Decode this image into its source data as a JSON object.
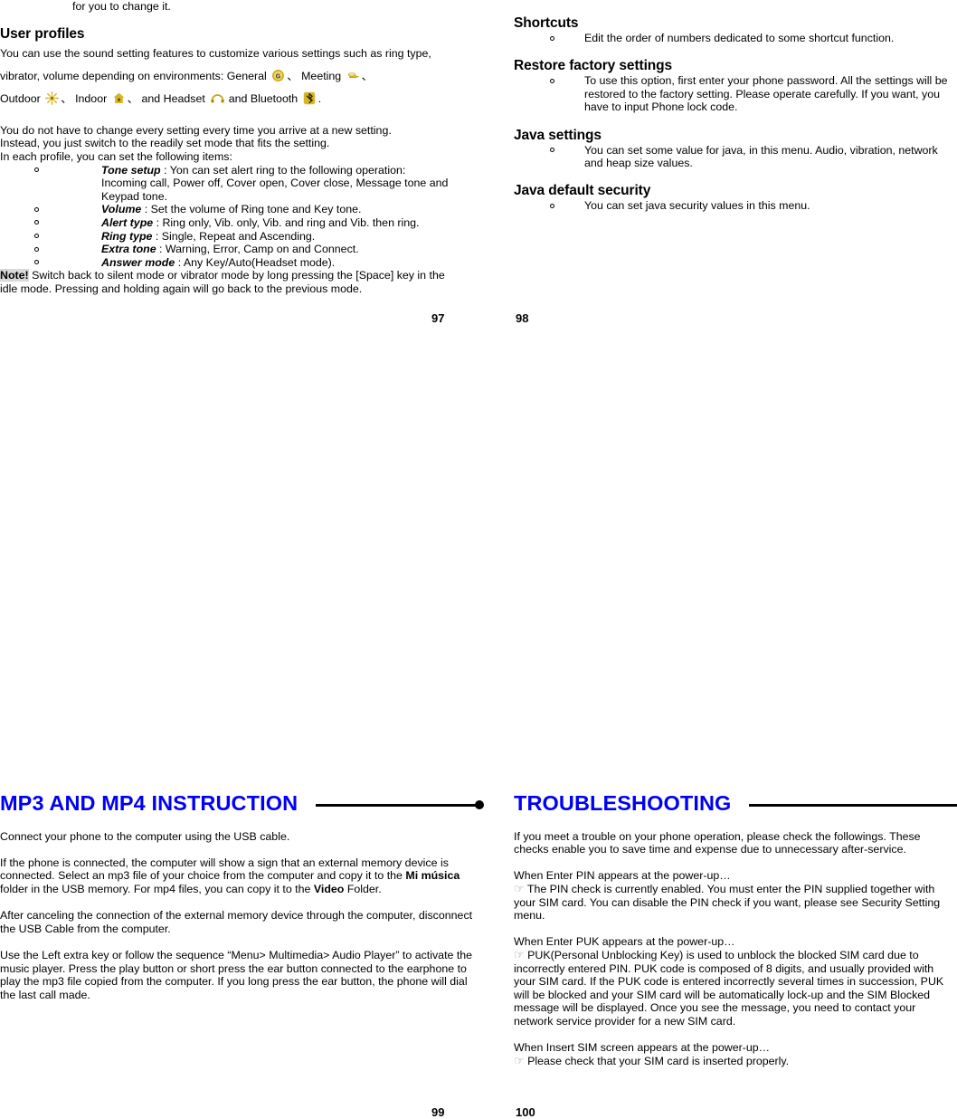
{
  "document": {
    "title": "Mobile Phone User Manual",
    "accent_heading_color": "#0000f5",
    "icon_gold": "#d9b828"
  },
  "page_numbers": {
    "top_left": "97",
    "top_right": "98",
    "bottom_left": "99",
    "bottom_right": "100"
  },
  "top_left_column": {
    "continued_line": "for you to change it.",
    "heading": "User profiles",
    "intro_part1": "You can use the sound setting features to customize various settings such as ring type, vibrator, volume depending on environments: General",
    "sep1": "、",
    "label_meeting": "Meeting",
    "sep2": "、",
    "label_outdoor": "Outdoor",
    "sep3": "、",
    "label_indoor": "Indoor",
    "sep4": "、",
    "label_headset": "and Headset",
    "label_bluetooth": "and Bluetooth",
    "period": ".",
    "paragraph2_line1": "You do not have to change every setting every time you arrive at a new setting.",
    "paragraph2_line2": "Instead, you just switch to the readily set mode that fits the setting.",
    "paragraph2_line3": "In each profile, you can set the following items:",
    "items": [
      {
        "term": "Tone setup",
        "text": " : Yon can set alert ring to the following operation: Incoming call, Power off, Cover open, Cover close, Message tone and Keypad tone."
      },
      {
        "term": "Volume",
        "text": " : Set the volume of Ring tone and Key tone."
      },
      {
        "term": "Alert type",
        "text": " : Ring only, Vib. only, Vib. and ring and Vib. then ring."
      },
      {
        "term": "Ring type",
        "text": " : Single, Repeat and Ascending."
      },
      {
        "term": "Extra tone",
        "text": " : Warning, Error, Camp on and Connect."
      },
      {
        "term": "Answer mode",
        "text": " : Any Key/Auto(Headset mode)."
      }
    ],
    "note_label": "Note!",
    "note_text": " Switch back to silent mode or vibrator mode by long pressing the [Space] key in the idle mode. Pressing and holding again will go back to the previous mode."
  },
  "top_right_column": {
    "sections": [
      {
        "heading": "Shortcuts",
        "items": [
          "Edit the order of numbers dedicated to some shortcut function."
        ]
      },
      {
        "heading": "Restore factory settings",
        "items": [
          "To use this option, first enter your phone password. All the settings will be restored to the factory setting. Please operate carefully. If you want, you have to input Phone lock code."
        ]
      },
      {
        "heading": "Java settings",
        "items": [
          "You can set some value for java, in this menu. Audio, vibration, network and heap size values."
        ]
      },
      {
        "heading": "Java default security",
        "items": [
          "You can set java security values in this menu."
        ]
      }
    ]
  },
  "bottom_left_column": {
    "chapter_title": "MP3 AND MP4 INSTRUCTION",
    "para1": "Connect your phone to the computer using the USB cable.",
    "para2_a": "If the phone is connected, the computer will show a sign that an external memory device is connected. Select an mp3 file of your choice from the computer and copy it to the ",
    "para2_b": "Mi música",
    "para2_c": " folder in the USB memory. For mp4 files, you can copy it to the ",
    "para2_d": "Video",
    "para2_e": " Folder.",
    "para3": "After canceling the connection of the external memory device through the computer, disconnect the USB Cable from the computer.",
    "para4": "Use the Left extra key or follow the sequence “Menu> Multimedia> Audio Player” to activate the music player. Press the play button or short press the ear button connected to the earphone to play the mp3 file copied from the computer. If you long press the ear button, the phone will dial the last call made."
  },
  "bottom_right_column": {
    "chapter_title": "TROUBLESHOOTING",
    "intro": "If you meet a trouble on your phone operation, please check the followings. These checks enable you to save time and expense due to unnecessary after-service.",
    "entries": [
      {
        "question": "When Enter PIN appears at the power-up…",
        "hand_icon": "☞",
        "answer": "The PIN check is currently enabled. You must enter the PIN supplied together with your SIM card. You can disable the PIN check if you want, please see Security Setting menu."
      },
      {
        "question": "When Enter PUK appears at the power-up…",
        "hand_icon": "☞",
        "answer": "PUK(Personal Unblocking Key) is used to unblock the blocked SIM card due to incorrectly entered PIN. PUK code is composed of 8 digits, and usually provided with your SIM card. If the PUK code is entered incorrectly several times in succession, PUK will be blocked and your SIM card will be automatically lock-up and the SIM Blocked message will be displayed. Once you see the message, you need to contact your network service provider for a new SIM card."
      },
      {
        "question": "When Insert SIM screen appears at the power-up…",
        "hand_icon": "☞",
        "answer": "Please check that your SIM card is inserted properly."
      }
    ]
  },
  "icons": {
    "general": "general-profile-icon",
    "meeting": "meeting-profile-icon",
    "outdoor": "outdoor-profile-icon",
    "indoor": "indoor-profile-icon",
    "headset": "headset-profile-icon",
    "bluetooth": "bluetooth-profile-icon"
  }
}
